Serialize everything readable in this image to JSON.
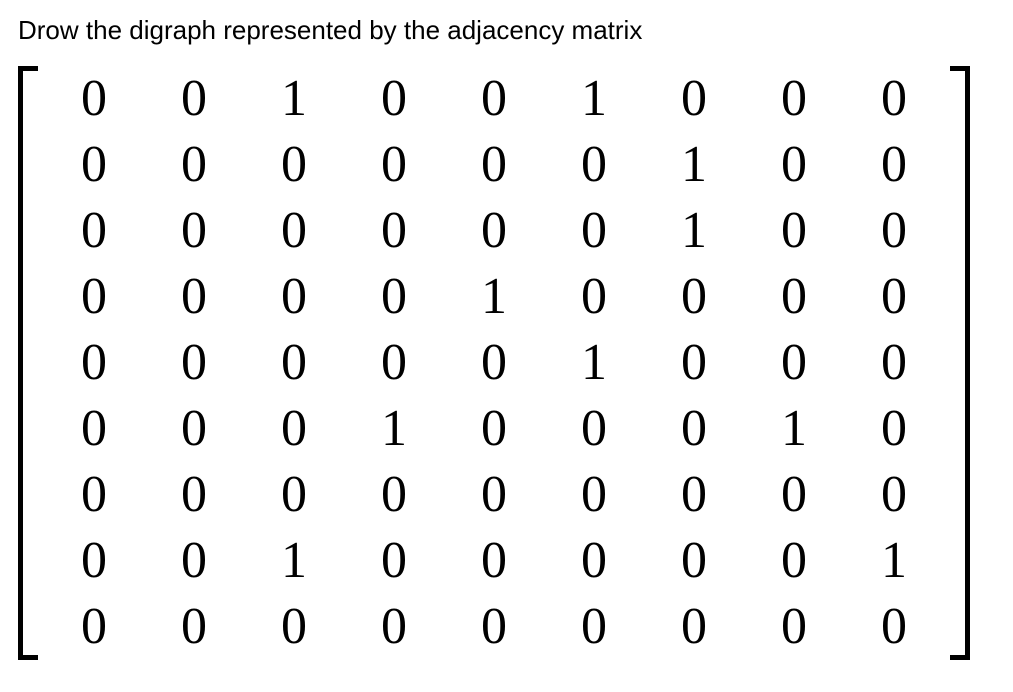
{
  "prompt_text": "Drow the digraph represented by the adjacency matrix",
  "matrix": {
    "rows": [
      [
        "0",
        "0",
        "1",
        "0",
        "0",
        "1",
        "0",
        "0",
        "0"
      ],
      [
        "0",
        "0",
        "0",
        "0",
        "0",
        "0",
        "1",
        "0",
        "0"
      ],
      [
        "0",
        "0",
        "0",
        "0",
        "0",
        "0",
        "1",
        "0",
        "0"
      ],
      [
        "0",
        "0",
        "0",
        "0",
        "1",
        "0",
        "0",
        "0",
        "0"
      ],
      [
        "0",
        "0",
        "0",
        "0",
        "0",
        "1",
        "0",
        "0",
        "0"
      ],
      [
        "0",
        "0",
        "0",
        "1",
        "0",
        "0",
        "0",
        "1",
        "0"
      ],
      [
        "0",
        "0",
        "0",
        "0",
        "0",
        "0",
        "0",
        "0",
        "0"
      ],
      [
        "0",
        "0",
        "1",
        "0",
        "0",
        "0",
        "0",
        "0",
        "1"
      ],
      [
        "0",
        "0",
        "0",
        "0",
        "0",
        "0",
        "0",
        "0",
        "0"
      ]
    ]
  }
}
